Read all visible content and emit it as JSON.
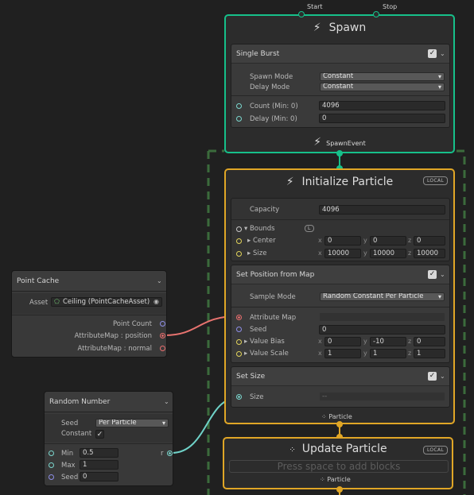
{
  "spawn": {
    "title": "Spawn",
    "start_label": "Start",
    "stop_label": "Stop",
    "output_label": "SpawnEvent",
    "block": {
      "title": "Single Burst",
      "spawn_mode_label": "Spawn Mode",
      "spawn_mode_value": "Constant",
      "delay_mode_label": "Delay Mode",
      "delay_mode_value": "Constant",
      "count_label": "Count (Min: 0)",
      "count_value": "4096",
      "delay_label": "Delay (Min: 0)",
      "delay_value": "0"
    }
  },
  "init": {
    "title": "Initialize Particle",
    "local_tag": "LOCAL",
    "capacity_label": "Capacity",
    "capacity_value": "4096",
    "bounds_label": "Bounds",
    "bounds_space": "L",
    "center_label": "Center",
    "center": {
      "x": "0",
      "y": "0",
      "z": "0"
    },
    "size_label": "Size",
    "size": {
      "x": "10000",
      "y": "10000",
      "z": "10000"
    },
    "axis": {
      "x": "x",
      "y": "y",
      "z": "z"
    },
    "set_position": {
      "title": "Set Position from Map",
      "sample_mode_label": "Sample Mode",
      "sample_mode_value": "Random Constant Per Particle",
      "attribute_map_label": "Attribute Map",
      "seed_label": "Seed",
      "seed_value": "0",
      "value_bias_label": "Value Bias",
      "value_bias": {
        "x": "0",
        "y": "-10",
        "z": "0"
      },
      "value_scale_label": "Value Scale",
      "value_scale": {
        "x": "1",
        "y": "1",
        "z": "1"
      }
    },
    "set_size": {
      "title": "Set Size",
      "size_label": "Size",
      "size_value": "--"
    },
    "output_label": "Particle"
  },
  "update": {
    "title": "Update Particle",
    "local_tag": "LOCAL",
    "placeholder": "Press space to add blocks",
    "output_label": "Particle"
  },
  "point_cache": {
    "title": "Point Cache",
    "asset_label": "Asset",
    "asset_value": "Ceiling (PointCacheAsset)",
    "outputs": [
      "Point Count",
      "AttributeMap : position",
      "AttributeMap : normal"
    ]
  },
  "random_number": {
    "title": "Random Number",
    "seed_label": "Seed",
    "seed_mode": "Per Particle",
    "constant_label": "Constant",
    "min_label": "Min",
    "min_value": "0.5",
    "max_label": "Max",
    "max_value": "1",
    "seed_in_label": "Seed",
    "seed_in_value": "0",
    "output_label": "r"
  },
  "colors": {
    "spawn_border": "#16c08a",
    "particle_border": "#e0a626",
    "texture_wire": "#e8736f",
    "float_wire": "#6fd2c8"
  }
}
